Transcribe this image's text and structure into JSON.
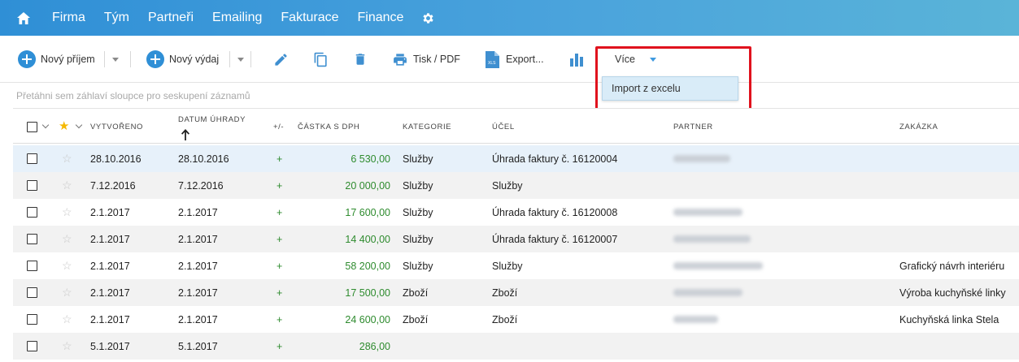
{
  "nav": {
    "items": [
      "Firma",
      "Tým",
      "Partneři",
      "Emailing",
      "Fakturace",
      "Finance"
    ]
  },
  "toolbar": {
    "new_income": "Nový příjem",
    "new_expense": "Nový výdaj",
    "print": "Tisk / PDF",
    "export": "Export...",
    "more": "Více"
  },
  "dropdown": {
    "import_excel": "Import z excelu"
  },
  "group_hint": "Přetáhni sem záhlaví sloupce pro seskupení záznamů",
  "columns": {
    "created": "VYTVOŘENO",
    "paid_date": "DATUM ÚHRADY",
    "sign": "+/-",
    "amount": "ČÁSTKA S DPH",
    "category": "KATEGORIE",
    "purpose": "ÚČEL",
    "partner": "PARTNER",
    "order": "ZAKÁZKA"
  },
  "rows": [
    {
      "created": "28.10.2016",
      "paid": "28.10.2016",
      "sign": "+",
      "amount": "6 530,00",
      "category": "Služby",
      "purpose": "Úhrada faktury č. 16120004",
      "partner_blurred": true,
      "order": ""
    },
    {
      "created": "7.12.2016",
      "paid": "7.12.2016",
      "sign": "+",
      "amount": "20 000,00",
      "category": "Služby",
      "purpose": "Služby",
      "partner_blurred": false,
      "order": ""
    },
    {
      "created": "2.1.2017",
      "paid": "2.1.2017",
      "sign": "+",
      "amount": "17 600,00",
      "category": "Služby",
      "purpose": "Úhrada faktury č. 16120008",
      "partner_blurred": true,
      "order": ""
    },
    {
      "created": "2.1.2017",
      "paid": "2.1.2017",
      "sign": "+",
      "amount": "14 400,00",
      "category": "Služby",
      "purpose": "Úhrada faktury č. 16120007",
      "partner_blurred": true,
      "order": ""
    },
    {
      "created": "2.1.2017",
      "paid": "2.1.2017",
      "sign": "+",
      "amount": "58 200,00",
      "category": "Služby",
      "purpose": "Služby",
      "partner_blurred": true,
      "order": "Grafický návrh interiéru"
    },
    {
      "created": "2.1.2017",
      "paid": "2.1.2017",
      "sign": "+",
      "amount": "17 500,00",
      "category": "Zboží",
      "purpose": "Zboží",
      "partner_blurred": true,
      "order": "Výroba kuchyňské linky"
    },
    {
      "created": "2.1.2017",
      "paid": "2.1.2017",
      "sign": "+",
      "amount": "24 600,00",
      "category": "Zboží",
      "purpose": "Zboží",
      "partner_blurred": true,
      "order": "Kuchyňská linka Stela"
    },
    {
      "created": "5.1.2017",
      "paid": "5.1.2017",
      "sign": "+",
      "amount": "286,00",
      "category": "",
      "purpose": "",
      "partner_blurred": false,
      "order": ""
    }
  ],
  "colors": {
    "nav_start": "#2f8fd6",
    "nav_end": "#5ab4d8",
    "accent": "#2f8fd6",
    "positive": "#2e8b2e",
    "highlight": "#e0121d"
  }
}
